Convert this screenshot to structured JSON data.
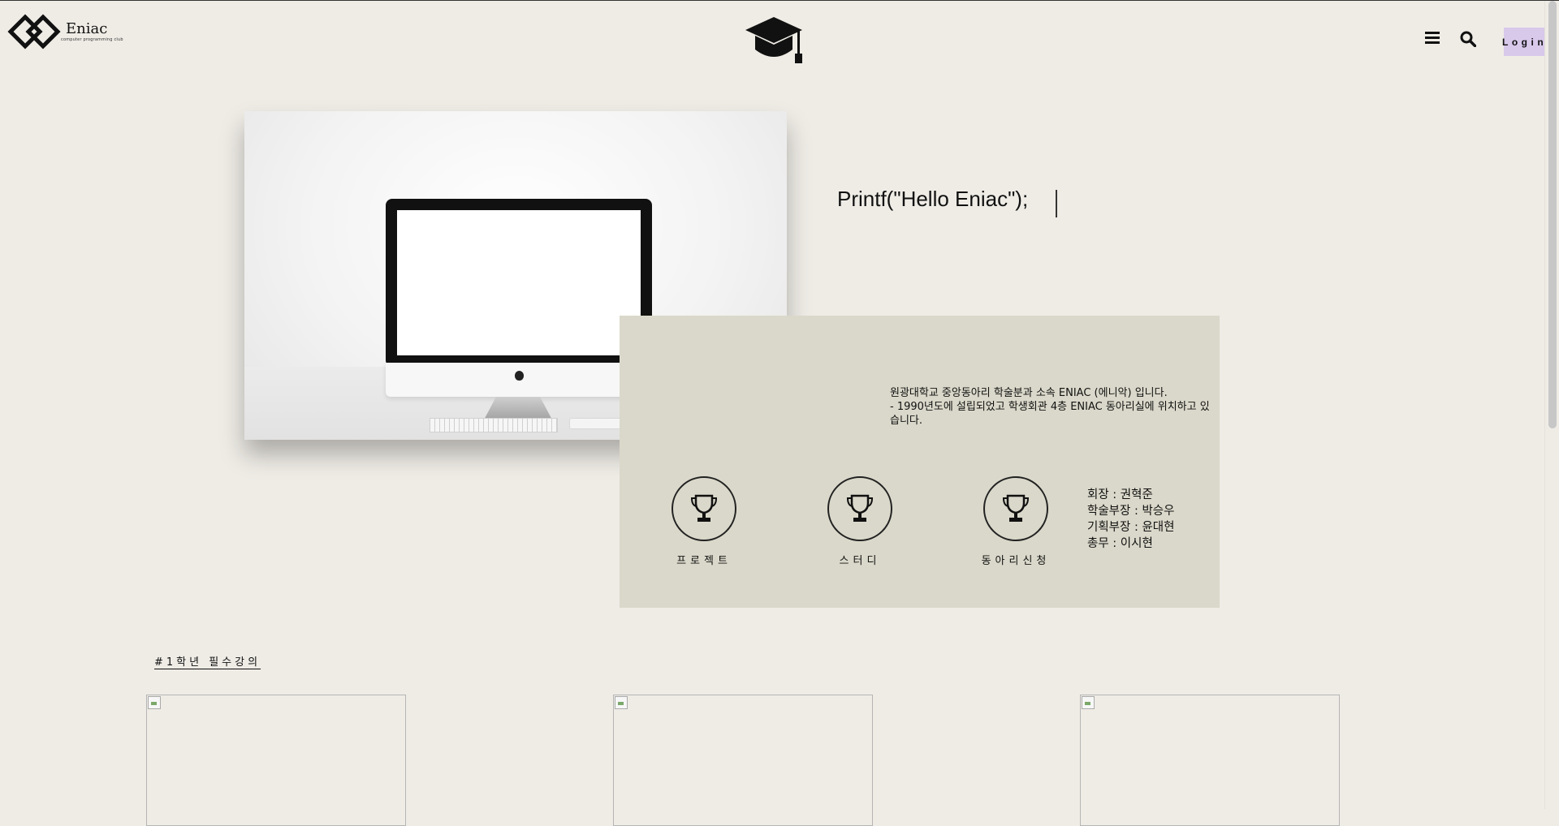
{
  "header": {
    "logo_name": "Eniac",
    "logo_tagline": "computer programming club",
    "login_label": "Login"
  },
  "hero": {
    "typing_text": "Printf(\"Hello Eniac\");"
  },
  "intro": {
    "line1": "원광대학교 중앙동아리 학술분과 소속 ENIAC (에니악) 입니다.",
    "line2": "- 1990년도에 설립되었고 학생회관 4층 ENIAC 동아리실에 위치하고 있습니다."
  },
  "features": [
    {
      "label": "프로젝트",
      "icon": "trophy-icon"
    },
    {
      "label": "스터디",
      "icon": "trophy-icon"
    },
    {
      "label": "동아리신청",
      "icon": "trophy-icon"
    }
  ],
  "officers": [
    "회장 : 권혁준",
    "학술부장 : 박승우",
    "기획부장 : 윤대현",
    "총무 : 이시현"
  ],
  "courses": {
    "section_title": "#1학년 필수강의"
  },
  "colors": {
    "background": "#efece6",
    "panel": "#dad8ca",
    "login_accent": "#d8c8ea"
  }
}
